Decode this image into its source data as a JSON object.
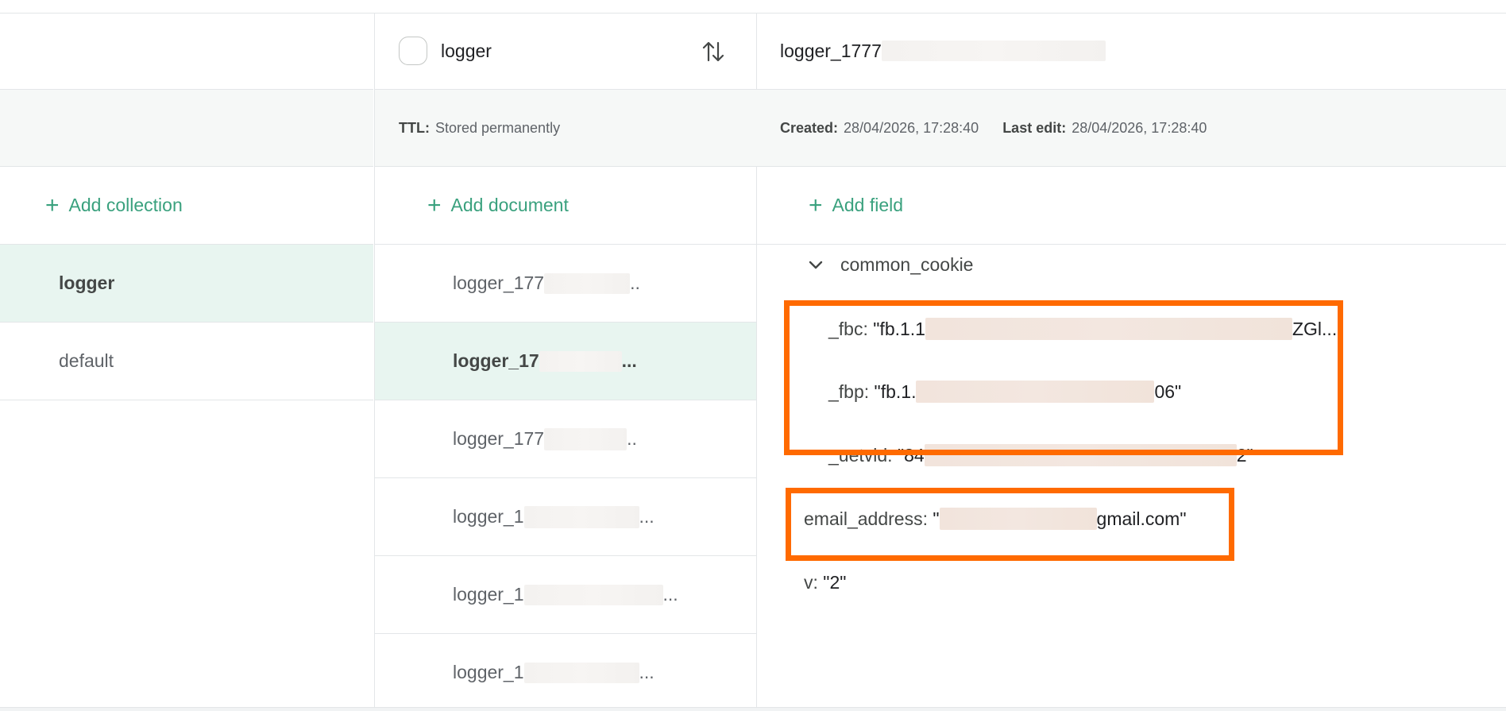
{
  "collections": {
    "add_label": "Add collection",
    "items": [
      {
        "label": "logger",
        "selected": true
      },
      {
        "label": "default",
        "selected": false
      }
    ]
  },
  "documents": {
    "header_title": "logger",
    "ttl_key": "TTL:",
    "ttl_value": "Stored permanently",
    "add_label": "Add document",
    "items": [
      {
        "prefix": "logger_177",
        "suffix": "..",
        "selected": false
      },
      {
        "prefix": "logger_17",
        "suffix": "...",
        "selected": true
      },
      {
        "prefix": "logger_177",
        "suffix": "..",
        "selected": false
      },
      {
        "prefix": "logger_1",
        "suffix": "...",
        "selected": false
      },
      {
        "prefix": "logger_1",
        "suffix": "...",
        "selected": false
      },
      {
        "prefix": "logger_1",
        "suffix": "...",
        "selected": false
      }
    ]
  },
  "document_view": {
    "title_prefix": "logger_1777",
    "created_key": "Created:",
    "created_value": "28/04/2026, 17:28:40",
    "last_edit_key": "Last edit:",
    "last_edit_value": "28/04/2026, 17:28:40",
    "add_field_label": "Add field",
    "group_name": "common_cookie",
    "fields": {
      "fbc_key": "_fbc:",
      "fbc_val_start": "\"fb.1.1",
      "fbc_val_end": "ZGl...",
      "fbp_key": "_fbp:",
      "fbp_val_start": "\"fb.1.",
      "fbp_val_end": "06\"",
      "uetvid_key": "_uetvid:",
      "uetvid_val_start": "\"84",
      "uetvid_val_end": "2\"",
      "email_key": "email_address:",
      "email_val_start": "\"",
      "email_val_end": "gmail.com\"",
      "v_key": "v:",
      "v_val": "\"2\""
    }
  },
  "colors": {
    "accent": "#3aa17e",
    "selected_bg": "#e8f5f0",
    "highlight": "#ff6a00"
  },
  "icons": {
    "plus": "plus-icon",
    "sort": "sort-arrows-icon",
    "chevron": "chevron-down-icon"
  }
}
